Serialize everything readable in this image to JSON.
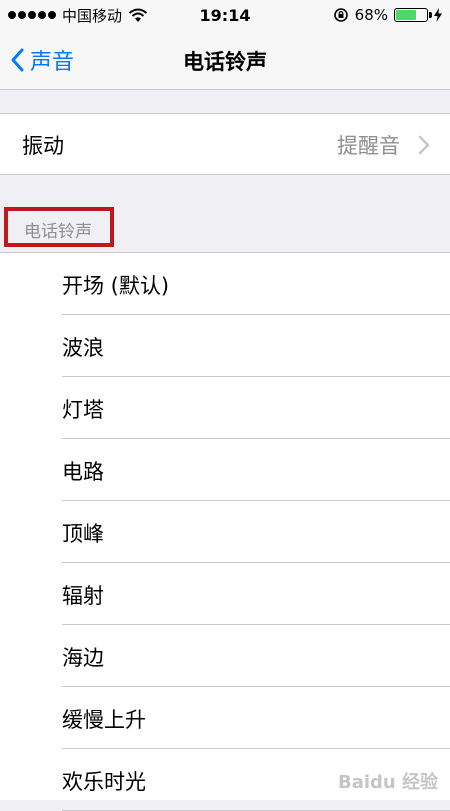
{
  "status_bar": {
    "carrier": "中国移动",
    "time": "19:14",
    "battery_percent": "68%",
    "battery_level": 0.68,
    "signal_icon": "signal-dots-icon",
    "wifi_icon": "wifi-icon",
    "rotation_lock_icon": "rotation-lock-icon",
    "charging_icon": "charging-bolt-icon"
  },
  "nav": {
    "back_label": "声音",
    "title": "电话铃声"
  },
  "vibration": {
    "label": "振动",
    "value": "提醒音"
  },
  "section": {
    "header": "电话铃声"
  },
  "ringtones": [
    "开场 (默认)",
    "波浪",
    "灯塔",
    "电路",
    "顶峰",
    "辐射",
    "海边",
    "缓慢上升",
    "欢乐时光"
  ],
  "watermark": "Baidu 经验",
  "colors": {
    "accent": "#007aff",
    "highlight_box": "#c0161d",
    "battery": "#4cd964"
  }
}
